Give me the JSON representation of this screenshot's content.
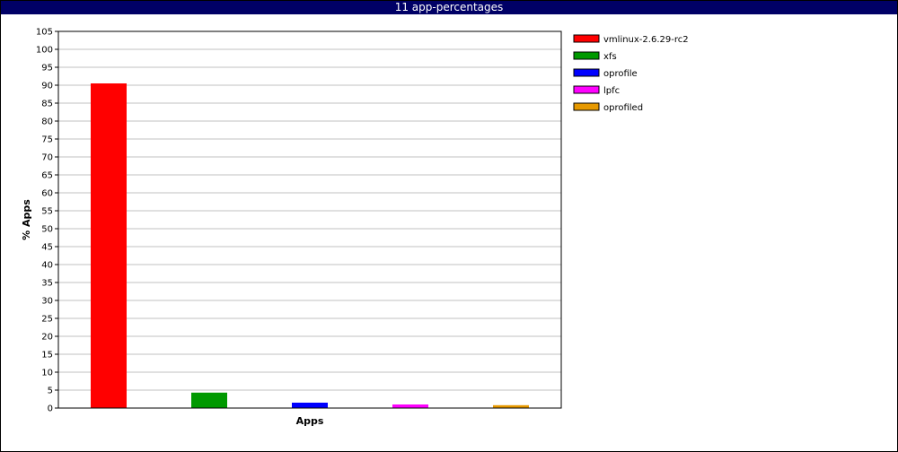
{
  "window": {
    "title": "11 app-percentages"
  },
  "chart_data": {
    "type": "bar",
    "title": "11 app-percentages",
    "xlabel": "Apps",
    "ylabel": "% Apps",
    "ylim": [
      0,
      105
    ],
    "ytick_step": 5,
    "grid": true,
    "legend_position": "right",
    "series": [
      {
        "name": "vmlinux-2.6.29-rc2",
        "value": 90.5,
        "color": "#ff0000"
      },
      {
        "name": "xfs",
        "value": 4.3,
        "color": "#009900"
      },
      {
        "name": "oprofile",
        "value": 1.5,
        "color": "#0000ff"
      },
      {
        "name": "lpfc",
        "value": 1.0,
        "color": "#ff00ff"
      },
      {
        "name": "oprofiled",
        "value": 0.8,
        "color": "#e69900"
      }
    ]
  }
}
